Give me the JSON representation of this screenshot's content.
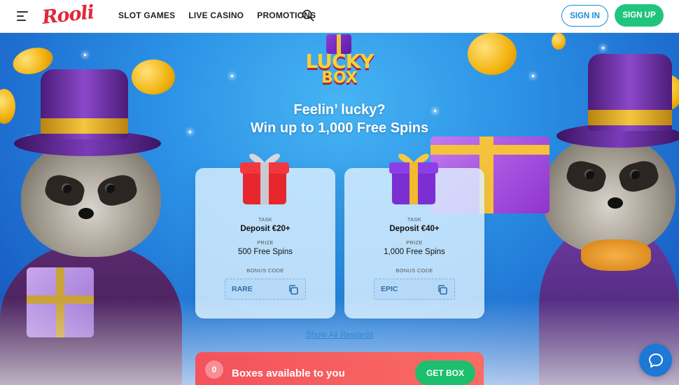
{
  "header": {
    "logo": "Rooli",
    "nav": [
      "SLOT GAMES",
      "LIVE CASINO",
      "PROMOTIONS"
    ],
    "sign_in": "SIGN IN",
    "sign_up": "SIGN UP"
  },
  "hero": {
    "logo_line1": "LUCKY",
    "logo_line2": "BOX",
    "headline_line1": "Feelin’ lucky?",
    "headline_line2": "Win up to 1,000 Free Spins"
  },
  "cards": [
    {
      "task_label": "TASK",
      "task": "Deposit €20+",
      "prize_label": "PRIZE",
      "prize": "500 Free Spins",
      "code_label": "BONUS CODE",
      "code": "RARE",
      "gift_color": "#e8262e",
      "ribbon_color": "#c9c9cf"
    },
    {
      "task_label": "TASK",
      "task": "Deposit €40+",
      "prize_label": "PRIZE",
      "prize": "1,000 Free Spins",
      "code_label": "BONUS CODE",
      "code": "EPIC",
      "gift_color": "#7b2fd3",
      "ribbon_color": "#f4b92d"
    }
  ],
  "show_all": "Show All Rewards",
  "boxes_bar": {
    "count": "0",
    "text": "Boxes available to you",
    "button": "GET BOX"
  },
  "colors": {
    "brand_red": "#e0283a",
    "sign_in_blue": "#1b8ad6",
    "sign_up_green": "#20c57d",
    "get_box_green": "#1dbf6e",
    "chat_blue": "#1d78d6"
  },
  "icons": [
    "menu-icon",
    "search-icon",
    "copy-icon",
    "chat-icon"
  ]
}
